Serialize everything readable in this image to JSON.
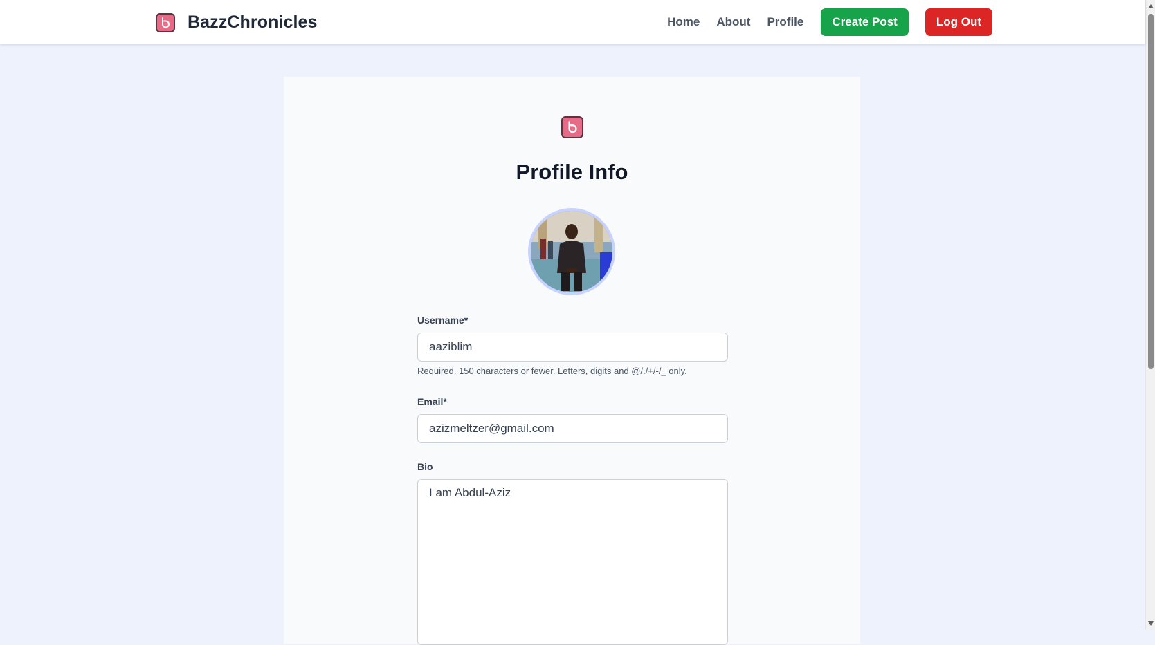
{
  "nav": {
    "brand": "BazzChronicles",
    "links": [
      "Home",
      "About",
      "Profile"
    ],
    "create_post": "Create Post",
    "log_out": "Log Out"
  },
  "card": {
    "title": "Profile Info",
    "fields": {
      "username": {
        "label": "Username*",
        "value": "aaziblim",
        "help": "Required. 150 characters or fewer. Letters, digits and @/./+/-/_ only."
      },
      "email": {
        "label": "Email*",
        "value": "azizmeltzer@gmail.com"
      },
      "bio": {
        "label": "Bio",
        "value": "I am Abdul-Aziz"
      }
    }
  },
  "colors": {
    "page_bg": "#edf2fd",
    "card_bg": "#f8fafc",
    "create_button": "#16a34a",
    "logout_button": "#dc2626",
    "logo_pink": "#e56b86",
    "avatar_ring": "#c7d2fe"
  },
  "icons": {
    "brand_logo": "bazz-logo-icon",
    "card_logo": "bazz-logo-icon"
  }
}
